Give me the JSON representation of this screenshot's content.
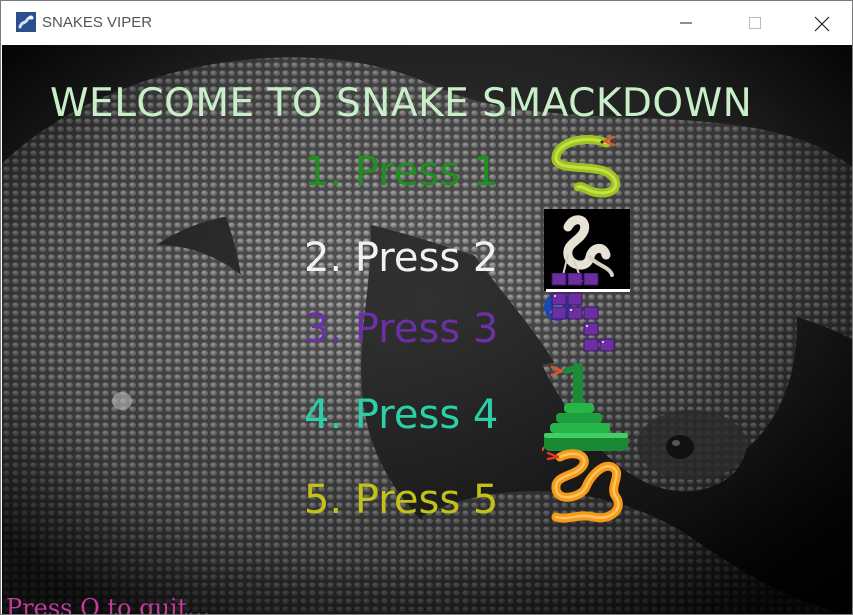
{
  "window": {
    "title": "SNAKES VIPER",
    "app_icon": "snake-app-icon",
    "controls": [
      "minimize-icon",
      "maximize-icon",
      "close-icon"
    ]
  },
  "game": {
    "heading": "WELCOME TO SNAKE SMACKDOWN",
    "options": [
      {
        "label": "1. Press 1",
        "color": "#1f8f1f",
        "icon": "green-snake-icon"
      },
      {
        "label": "2. Press 2",
        "color": "#f2f2f2",
        "icon": "white-snake-icon"
      },
      {
        "label": "3. Press 3",
        "color": "#6b2fa6",
        "icon": "purple-block-snake-icon"
      },
      {
        "label": "4. Press 4",
        "color": "#2bcfa8",
        "icon": "coiled-green-snake-icon"
      },
      {
        "label": "5. Press 5",
        "color": "#c2c21a",
        "icon": "orange-snake-icon"
      }
    ],
    "quit_hint": "Press Q to quit...",
    "colors": {
      "heading": "#c9efc9",
      "quit_hint": "#c23a9c",
      "background": "#000000"
    }
  }
}
